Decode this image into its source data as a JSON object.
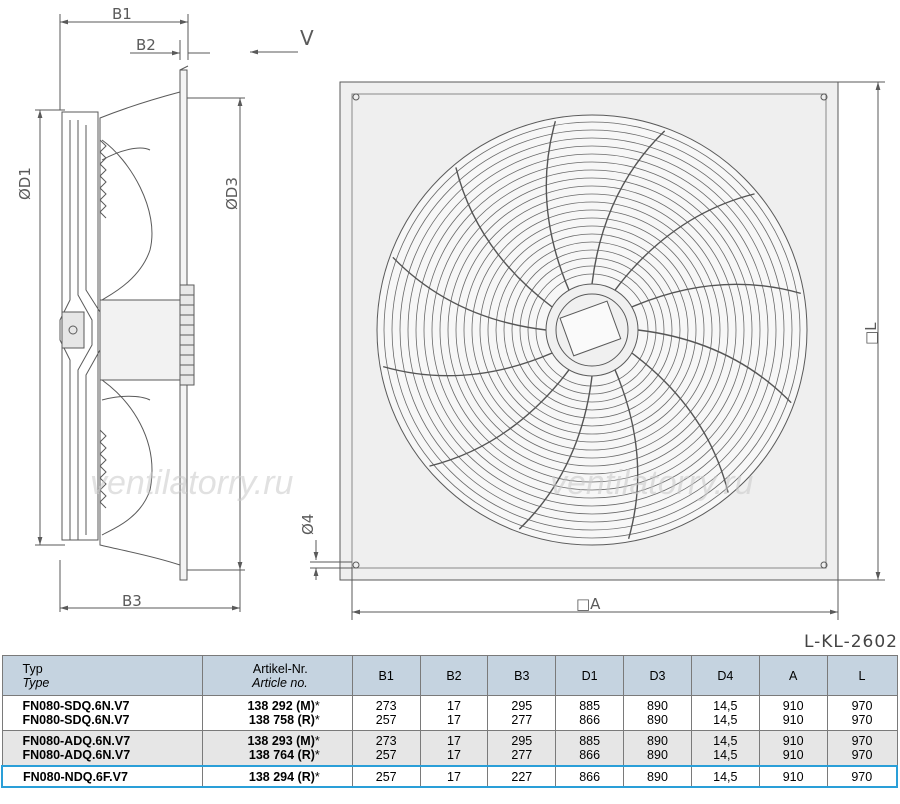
{
  "drawing": {
    "dims": {
      "b1": "B1",
      "b2": "B2",
      "b3": "B3",
      "v": "V",
      "d1": "ØD1",
      "d3": "ØD3",
      "d4": "Ø4",
      "a": "□A",
      "l": "□L"
    },
    "drawing_ref": "L-KL-2602",
    "watermark": "ventilatorry.ru",
    "colors": {
      "line": "#5a5a5a",
      "panel": "#efefef",
      "header": "#c5d3e0",
      "group": "#e6e6e6",
      "highlight": "#2a9fd8"
    }
  },
  "table": {
    "headers": {
      "typ": "Typ",
      "type": "Type",
      "art": "Artikel-Nr.",
      "article": "Article no.",
      "b1": "B1",
      "b2": "B2",
      "b3": "B3",
      "d1": "D1",
      "d3": "D3",
      "d4": "D4",
      "a": "A",
      "l": "L"
    },
    "rows": [
      {
        "type": [
          "FN080-SDQ.6N.V7",
          "FN080-SDQ.6N.V7"
        ],
        "article": [
          "138 292 (M)",
          "138 758 (R)"
        ],
        "b1": [
          "273",
          "257"
        ],
        "b2": [
          "17",
          "17"
        ],
        "b3": [
          "295",
          "277"
        ],
        "d1": [
          "885",
          "866"
        ],
        "d3": [
          "890",
          "890"
        ],
        "d4": [
          "14,5",
          "14,5"
        ],
        "a": [
          "910",
          "910"
        ],
        "l": [
          "970",
          "970"
        ]
      },
      {
        "type": [
          "FN080-ADQ.6N.V7",
          "FN080-ADQ.6N.V7"
        ],
        "article": [
          "138 293 (M)",
          "138 764 (R)"
        ],
        "b1": [
          "273",
          "257"
        ],
        "b2": [
          "17",
          "17"
        ],
        "b3": [
          "295",
          "277"
        ],
        "d1": [
          "885",
          "866"
        ],
        "d3": [
          "890",
          "890"
        ],
        "d4": [
          "14,5",
          "14,5"
        ],
        "a": [
          "910",
          "910"
        ],
        "l": [
          "970",
          "970"
        ]
      },
      {
        "type": [
          "FN080-NDQ.6F.V7"
        ],
        "article": [
          "138 294 (R)"
        ],
        "b1": [
          "257"
        ],
        "b2": [
          "17"
        ],
        "b3": [
          "227"
        ],
        "d1": [
          "866"
        ],
        "d3": [
          "890"
        ],
        "d4": [
          "14,5"
        ],
        "a": [
          "910"
        ],
        "l": [
          "970"
        ]
      }
    ],
    "asterisk": "*"
  }
}
